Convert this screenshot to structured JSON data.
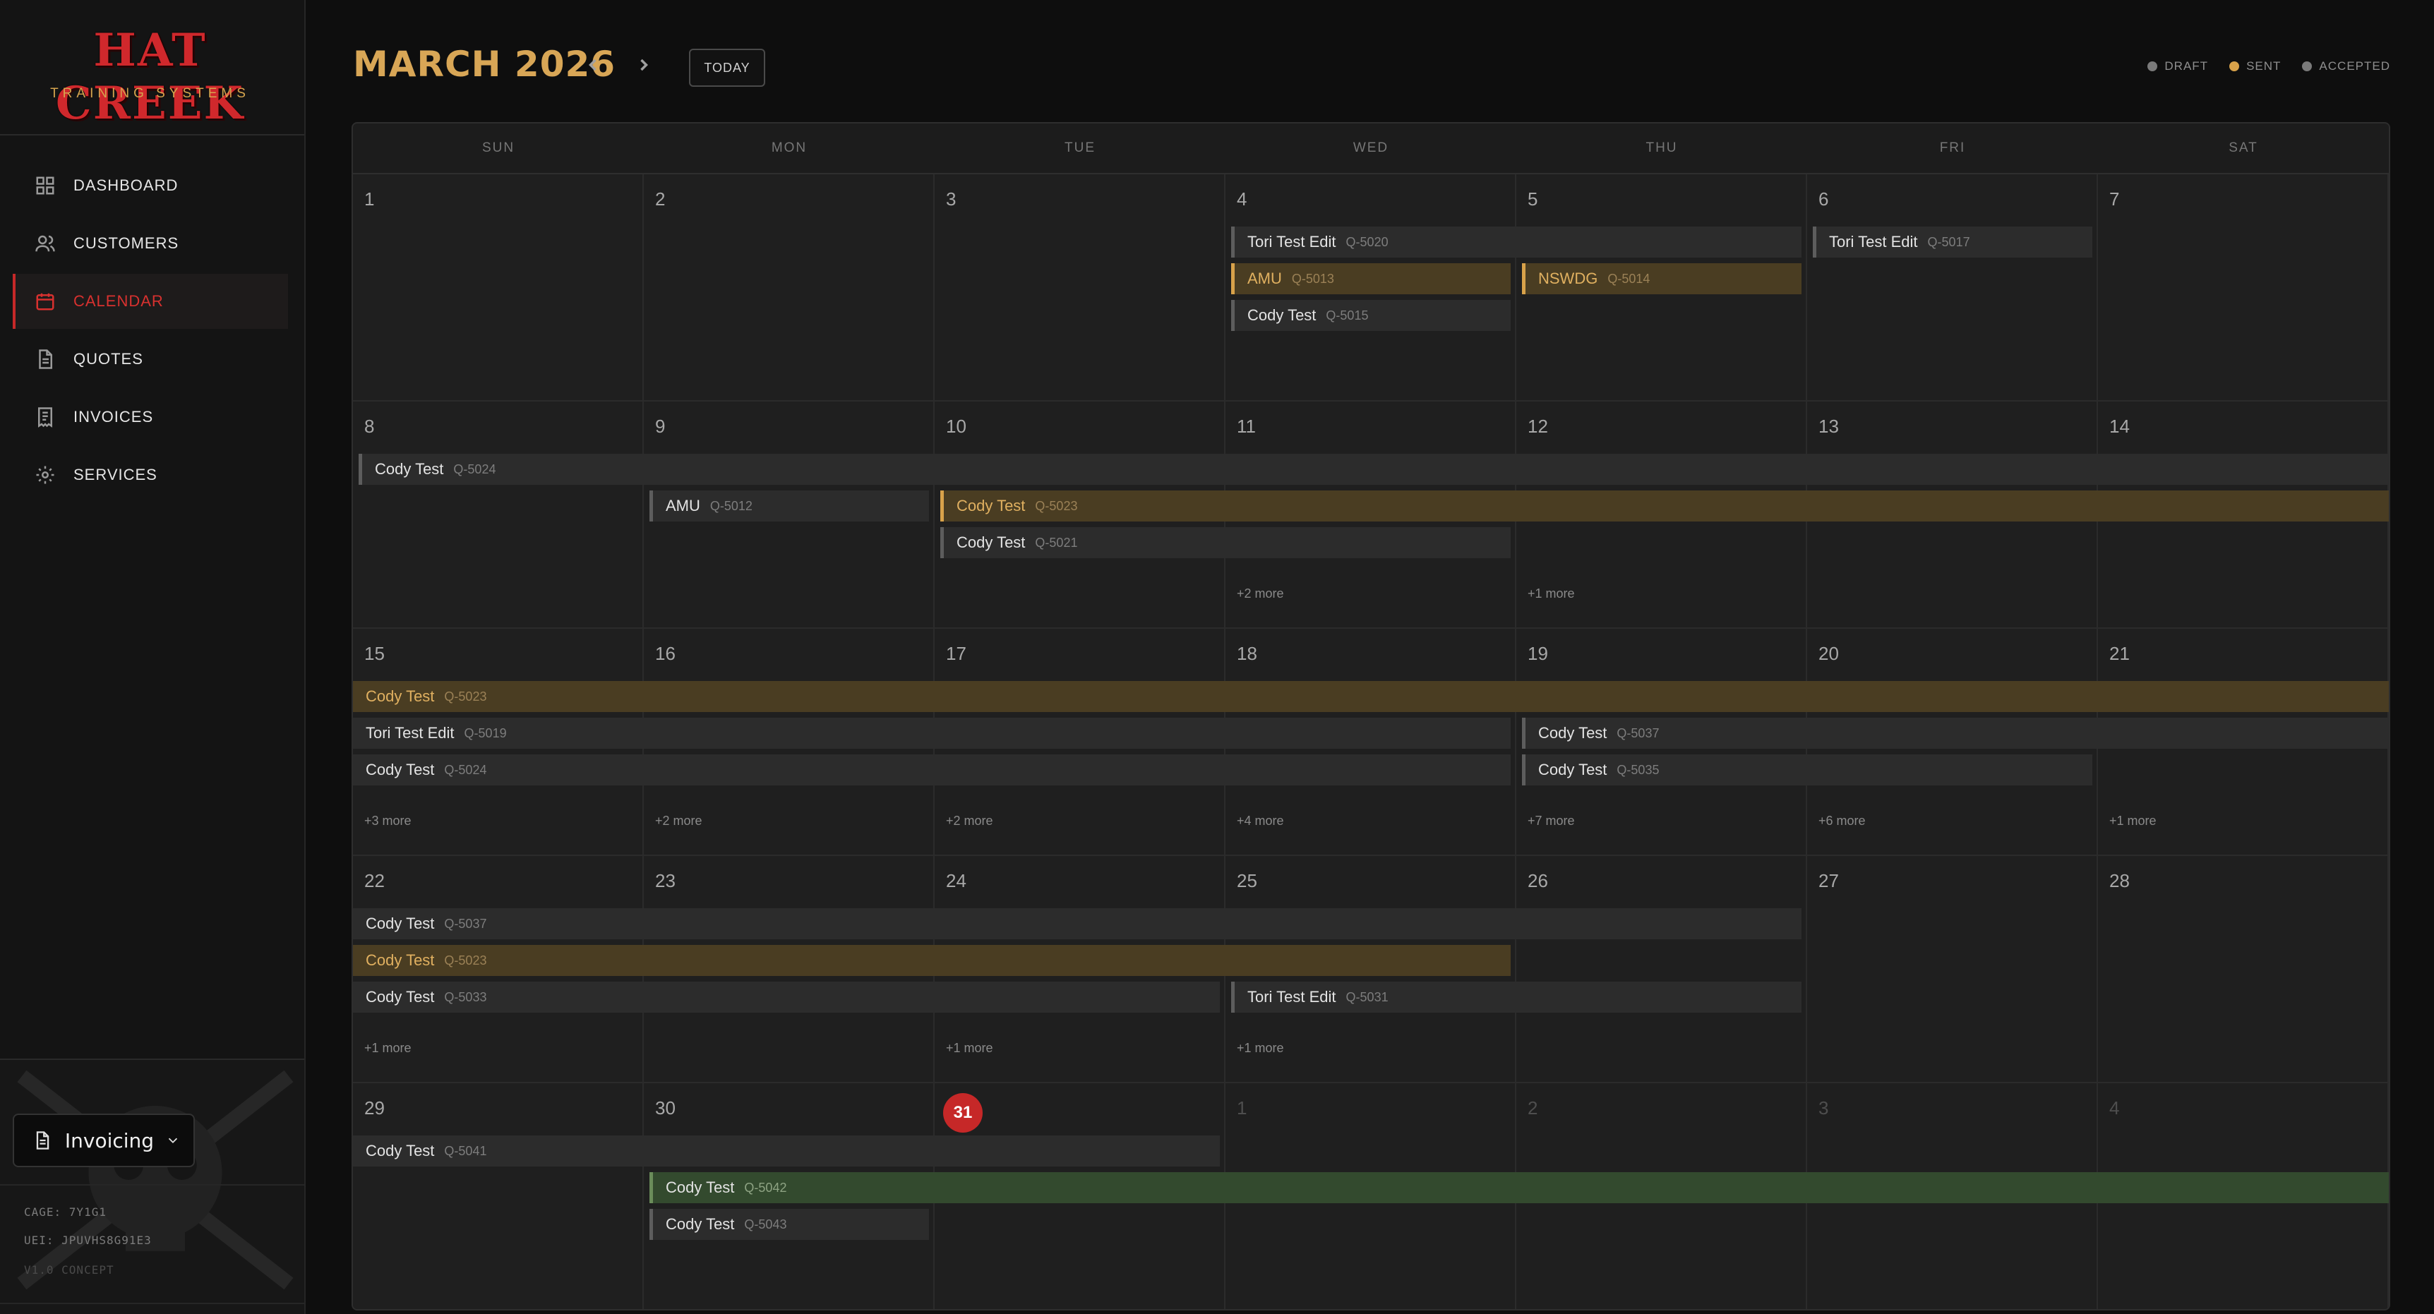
{
  "sidebar": {
    "logo_text": "HAT CREEK",
    "logo_sub": "TRAINING SYSTEMS",
    "items": [
      {
        "label": "DASHBOARD",
        "icon": "grid-icon"
      },
      {
        "label": "CUSTOMERS",
        "icon": "users-icon"
      },
      {
        "label": "CALENDAR",
        "icon": "calendar-icon",
        "active": true
      },
      {
        "label": "QUOTES",
        "icon": "document-icon"
      },
      {
        "label": "INVOICES",
        "icon": "receipt-icon"
      },
      {
        "label": "SERVICES",
        "icon": "gear-icon"
      }
    ],
    "mode_label": "Invoicing",
    "cage": "CAGE: 7Y1G1",
    "uei": "UEI: JPUVHS8G91E3",
    "version": "V1.0 CONCEPT"
  },
  "header": {
    "month_title": "MARCH 2026",
    "today_label": "TODAY",
    "legend": [
      {
        "label": "DRAFT",
        "color": "#7a7a7a"
      },
      {
        "label": "SENT",
        "color": "#d8a24a"
      },
      {
        "label": "ACCEPTED",
        "color": "#7a7a7a"
      }
    ]
  },
  "calendar": {
    "weekdays": [
      "SUN",
      "MON",
      "TUE",
      "WED",
      "THU",
      "FRI",
      "SAT"
    ],
    "weeks": [
      [
        {
          "day": "1"
        },
        {
          "day": "2"
        },
        {
          "day": "3"
        },
        {
          "day": "4"
        },
        {
          "day": "5"
        },
        {
          "day": "6"
        },
        {
          "day": "7"
        }
      ],
      [
        {
          "day": "8"
        },
        {
          "day": "9"
        },
        {
          "day": "10"
        },
        {
          "day": "11",
          "more": "+2 more"
        },
        {
          "day": "12",
          "more": "+1 more"
        },
        {
          "day": "13"
        },
        {
          "day": "14"
        }
      ],
      [
        {
          "day": "15",
          "more": "+3 more"
        },
        {
          "day": "16",
          "more": "+2 more"
        },
        {
          "day": "17",
          "more": "+2 more"
        },
        {
          "day": "18",
          "more": "+4 more"
        },
        {
          "day": "19",
          "more": "+7 more"
        },
        {
          "day": "20",
          "more": "+6 more"
        },
        {
          "day": "21",
          "more": "+1 more"
        }
      ],
      [
        {
          "day": "22",
          "more": "+1 more"
        },
        {
          "day": "23"
        },
        {
          "day": "24",
          "more": "+1 more"
        },
        {
          "day": "25",
          "more": "+1 more"
        },
        {
          "day": "26"
        },
        {
          "day": "27"
        },
        {
          "day": "28"
        }
      ],
      [
        {
          "day": "29"
        },
        {
          "day": "30"
        },
        {
          "day": "31",
          "today": true
        },
        {
          "day": "1",
          "other": true
        },
        {
          "day": "2",
          "other": true
        },
        {
          "day": "3",
          "other": true
        },
        {
          "day": "4",
          "other": true
        }
      ]
    ],
    "events": [
      {
        "week": 0,
        "start": 3,
        "span": 2,
        "lane": 0,
        "title": "Tori Test Edit",
        "qid": "Q-5020",
        "status": "draft"
      },
      {
        "week": 0,
        "start": 3,
        "span": 1,
        "lane": 1,
        "title": "AMU",
        "qid": "Q-5013",
        "status": "sent"
      },
      {
        "week": 0,
        "start": 3,
        "span": 1,
        "lane": 2,
        "title": "Cody Test",
        "qid": "Q-5015",
        "status": "draft"
      },
      {
        "week": 0,
        "start": 4,
        "span": 1,
        "lane": 1,
        "title": "NSWDG",
        "qid": "Q-5014",
        "status": "sent"
      },
      {
        "week": 0,
        "start": 5,
        "span": 1,
        "lane": 0,
        "title": "Tori Test Edit",
        "qid": "Q-5017",
        "status": "draft"
      },
      {
        "week": 1,
        "start": 0,
        "span": 7,
        "lane": 0,
        "title": "Cody Test",
        "qid": "Q-5024",
        "status": "draft"
      },
      {
        "week": 1,
        "start": 1,
        "span": 1,
        "lane": 1,
        "title": "AMU",
        "qid": "Q-5012",
        "status": "draft"
      },
      {
        "week": 1,
        "start": 2,
        "span": 5,
        "lane": 1,
        "title": "Cody Test",
        "qid": "Q-5023",
        "status": "sent"
      },
      {
        "week": 1,
        "start": 2,
        "span": 2,
        "lane": 2,
        "title": "Cody Test",
        "qid": "Q-5021",
        "status": "draft"
      },
      {
        "week": 2,
        "start": 0,
        "span": 7,
        "lane": 0,
        "title": "Cody Test",
        "qid": "Q-5023",
        "status": "sent",
        "cont": true
      },
      {
        "week": 2,
        "start": 0,
        "span": 4,
        "lane": 1,
        "title": "Tori Test Edit",
        "qid": "Q-5019",
        "status": "draft",
        "cont": true
      },
      {
        "week": 2,
        "start": 0,
        "span": 4,
        "lane": 2,
        "title": "Cody Test",
        "qid": "Q-5024",
        "status": "draft",
        "cont": true
      },
      {
        "week": 2,
        "start": 4,
        "span": 3,
        "lane": 1,
        "title": "Cody Test",
        "qid": "Q-5037",
        "status": "draft"
      },
      {
        "week": 2,
        "start": 4,
        "span": 2,
        "lane": 2,
        "title": "Cody Test",
        "qid": "Q-5035",
        "status": "draft"
      },
      {
        "week": 3,
        "start": 0,
        "span": 5,
        "lane": 0,
        "title": "Cody Test",
        "qid": "Q-5037",
        "status": "draft",
        "cont": true
      },
      {
        "week": 3,
        "start": 0,
        "span": 4,
        "lane": 1,
        "title": "Cody Test",
        "qid": "Q-5023",
        "status": "sent",
        "cont": true
      },
      {
        "week": 3,
        "start": 0,
        "span": 3,
        "lane": 2,
        "title": "Cody Test",
        "qid": "Q-5033",
        "status": "draft",
        "cont": true
      },
      {
        "week": 3,
        "start": 3,
        "span": 2,
        "lane": 2,
        "title": "Tori Test Edit",
        "qid": "Q-5031",
        "status": "draft"
      },
      {
        "week": 4,
        "start": 0,
        "span": 3,
        "lane": 0,
        "title": "Cody Test",
        "qid": "Q-5041",
        "status": "draft",
        "cont": true
      },
      {
        "week": 4,
        "start": 1,
        "span": 6,
        "lane": 1,
        "title": "Cody Test",
        "qid": "Q-5042",
        "status": "accepted"
      },
      {
        "week": 4,
        "start": 1,
        "span": 1,
        "lane": 2,
        "title": "Cody Test",
        "qid": "Q-5043",
        "status": "draft"
      }
    ]
  }
}
